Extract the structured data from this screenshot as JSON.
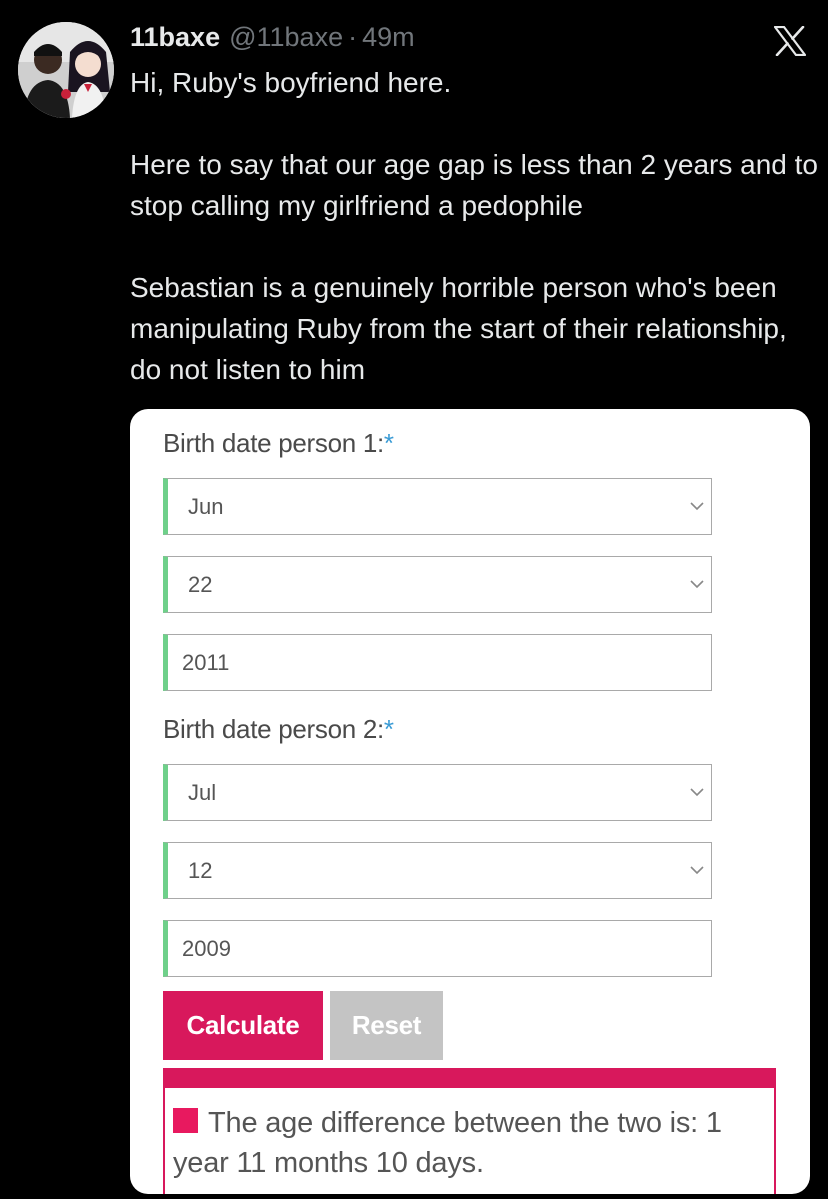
{
  "tweet": {
    "display_name": "11baxe",
    "handle": "@11baxe",
    "separator": "·",
    "time": "49m",
    "avatar_icon": "avatar-photo",
    "logo_icon": "x-logo",
    "paragraphs": [
      "Hi, Ruby's boyfriend here.",
      "Here to say that our age gap is less than 2 years and to stop calling my girlfriend a pedophile",
      "Sebastian is a genuinely horrible person who's been manipulating Ruby from the start of their relationship, do not listen to him"
    ]
  },
  "calculator": {
    "person1": {
      "label": "Birth date person 1:",
      "required_mark": "*",
      "month": "Jun",
      "day": "22",
      "year": "2011"
    },
    "person2": {
      "label": "Birth date person 2:",
      "required_mark": "*",
      "month": "Jul",
      "day": "12",
      "year": "2009"
    },
    "calculate_label": "Calculate",
    "reset_label": "Reset",
    "result_text": "The age difference between the two is: 1 year 11 months 10 days.",
    "colors": {
      "accent": "#d8185c",
      "field_border_left": "#6fd08a",
      "required": "#3a9bd5",
      "reset_bg": "#c4c4c4"
    }
  }
}
